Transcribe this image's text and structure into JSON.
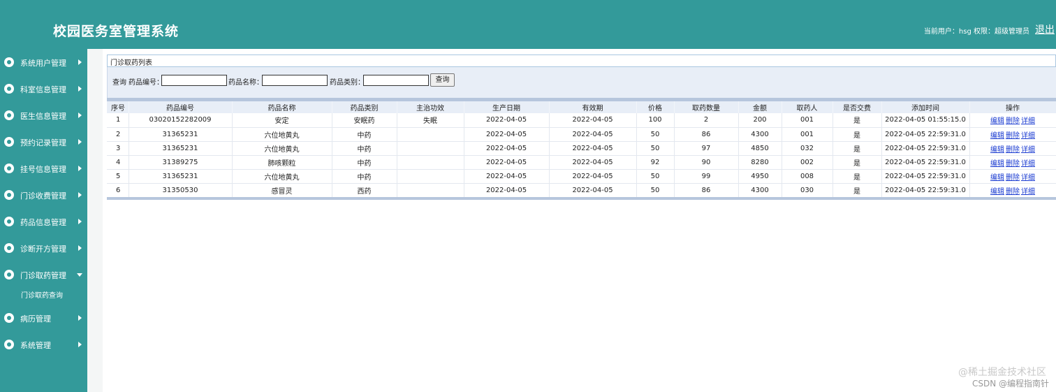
{
  "header": {
    "title": "校园医务室管理系统",
    "user_label": "当前用户：hsg  权限：超级管理员",
    "logout": "退出"
  },
  "sidebar": {
    "items": [
      {
        "label": "系统用户管理",
        "icon": "user-icon"
      },
      {
        "label": "科室信息管理",
        "icon": "dept-icon"
      },
      {
        "label": "医生信息管理",
        "icon": "doctor-icon"
      },
      {
        "label": "预约记录管理",
        "icon": "app-icon"
      },
      {
        "label": "挂号信息管理",
        "icon": "register-icon"
      },
      {
        "label": "门诊收费管理",
        "icon": "fee-icon"
      },
      {
        "label": "药品信息管理",
        "icon": "drug-icon"
      },
      {
        "label": "诊断开方管理",
        "icon": "diagnose-icon"
      },
      {
        "label": "门诊取药管理",
        "icon": "pickup-icon",
        "expanded": true
      },
      {
        "label": "病历管理",
        "icon": "record-icon"
      },
      {
        "label": "系统管理",
        "icon": "system-icon"
      }
    ],
    "submenu": {
      "label": "门诊取药查询"
    }
  },
  "panel": {
    "title": "门诊取药列表"
  },
  "search": {
    "query_label": "查询",
    "code_label": "药品编号：",
    "name_label": "药品名称：",
    "type_label": "药品类别：",
    "code_value": "",
    "name_value": "",
    "type_value": "",
    "button": "查询"
  },
  "table": {
    "headers": [
      "序号",
      "药品编号",
      "药品名称",
      "药品类别",
      "主治功效",
      "生产日期",
      "有效期",
      "价格",
      "取药数量",
      "金额",
      "取药人",
      "是否交费",
      "添加时间",
      "操作"
    ],
    "rows": [
      [
        "1",
        "03020152282009",
        "安定",
        "安眠药",
        "失眠",
        "2022-04-05",
        "2022-04-05",
        "100",
        "2",
        "200",
        "001",
        "是",
        "2022-04-05 01:55:15.0"
      ],
      [
        "2",
        "31365231",
        "六位地黄丸",
        "中药",
        "",
        "2022-04-05",
        "2022-04-05",
        "50",
        "86",
        "4300",
        "001",
        "是",
        "2022-04-05 22:59:31.0"
      ],
      [
        "3",
        "31365231",
        "六位地黄丸",
        "中药",
        "",
        "2022-04-05",
        "2022-04-05",
        "50",
        "97",
        "4850",
        "032",
        "是",
        "2022-04-05 22:59:31.0"
      ],
      [
        "4",
        "31389275",
        "肺咳颗粒",
        "中药",
        "",
        "2022-04-05",
        "2022-04-05",
        "92",
        "90",
        "8280",
        "002",
        "是",
        "2022-04-05 22:59:31.0"
      ],
      [
        "5",
        "31365231",
        "六位地黄丸",
        "中药",
        "",
        "2022-04-05",
        "2022-04-05",
        "50",
        "99",
        "4950",
        "008",
        "是",
        "2022-04-05 22:59:31.0"
      ],
      [
        "6",
        "31350530",
        "感冒灵",
        "西药",
        "",
        "2022-04-05",
        "2022-04-05",
        "50",
        "86",
        "4300",
        "030",
        "是",
        "2022-04-05 22:59:31.0"
      ]
    ],
    "actions": [
      "编辑",
      "删除",
      "详细"
    ]
  },
  "watermark": {
    "line1": "@稀土掘金技术社区",
    "line2": "CSDN @编程指南针"
  },
  "colors": {
    "brand": "#339a9a",
    "link": "#1a3bd1",
    "table_header": "#e8eef7"
  }
}
